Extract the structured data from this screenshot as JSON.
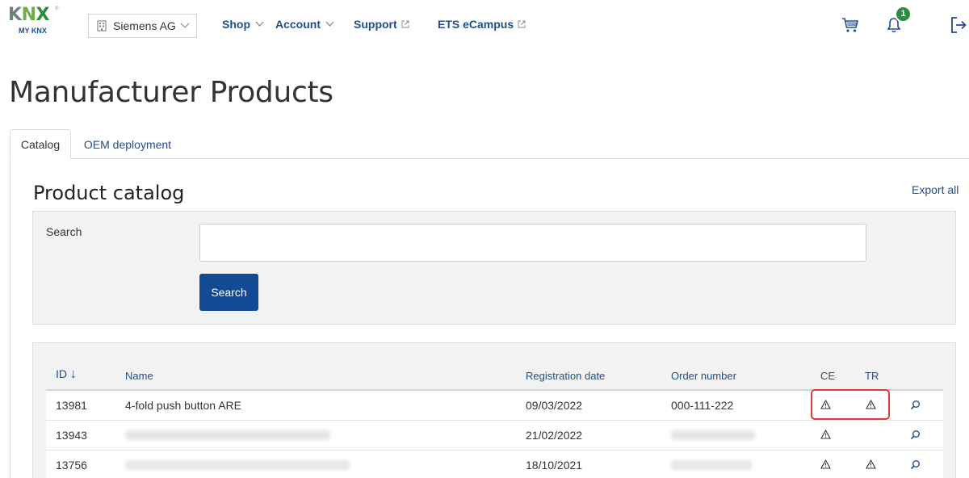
{
  "logo": {
    "brand": "KNX",
    "sub": "MY KNX"
  },
  "company_selector": {
    "label": "Siemens AG"
  },
  "nav": {
    "shop": "Shop",
    "account": "Account",
    "support": "Support",
    "ecampus": "ETS eCampus"
  },
  "notifications": {
    "count": "1"
  },
  "page_title": "Manufacturer Products",
  "tabs": [
    {
      "label": "Catalog",
      "active": true
    },
    {
      "label": "OEM deployment",
      "active": false
    }
  ],
  "catalog": {
    "title": "Product catalog",
    "export_label": "Export all",
    "search": {
      "label": "Search",
      "value": "",
      "button": "Search"
    }
  },
  "table": {
    "columns": [
      "ID",
      "Name",
      "Registration date",
      "Order number",
      "CE",
      "TR"
    ],
    "sort_indicator": "↓",
    "rows": [
      {
        "id": "13981",
        "name": "4-fold push button ARE",
        "date": "09/03/2022",
        "order": "000-111-222",
        "ce": true,
        "tr": true
      },
      {
        "id": "13943",
        "name": "",
        "date": "21/02/2022",
        "order": "",
        "ce": true,
        "tr": false
      },
      {
        "id": "13756",
        "name": "",
        "date": "18/10/2021",
        "order": "",
        "ce": true,
        "tr": true
      }
    ]
  },
  "colors": {
    "primary": "#124a94",
    "link": "#1f4e89",
    "badge": "#2e8b3d",
    "highlight": "#e53935"
  }
}
